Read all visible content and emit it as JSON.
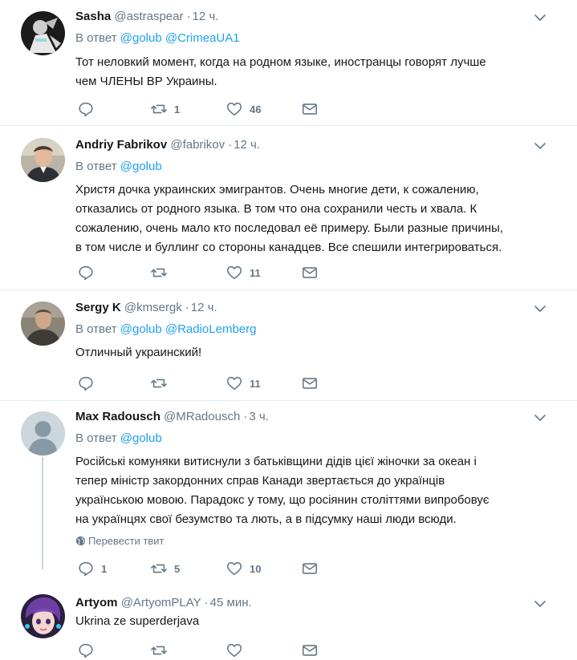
{
  "tweets": [
    {
      "name": "Sasha",
      "handle": "@astraspear",
      "time": "12 ч.",
      "reply_prefix": "В ответ",
      "mentions": [
        "@golub",
        "@CrimeaUA1"
      ],
      "lines": [
        "Тот неловкий момент, когда на родном языке, иностранцы говорят лучше",
        "чем ЧЛЕНЫ ВР Украины."
      ],
      "reply_count": "",
      "retweet_count": "1",
      "like_count": "46"
    },
    {
      "name": "Andriy Fabrikov",
      "handle": "@fabrikov",
      "time": "12 ч.",
      "reply_prefix": "В ответ",
      "mentions": [
        "@golub"
      ],
      "lines": [
        "Христя дочка украинских эмигрантов. Очень многие дети, к сожалению,",
        "отказались от родного языка. В том что она сохранили честь и хвала. К",
        "сожалению, очень мало кто последовал её примеру. Были разные причины,",
        "в том числе и буллинг со стороны канадцев. Все спешили интегрироваться."
      ],
      "reply_count": "",
      "retweet_count": "",
      "like_count": "11"
    },
    {
      "name": "Sergy K",
      "handle": "@kmsergk",
      "time": "12 ч.",
      "reply_prefix": "В ответ",
      "mentions": [
        "@golub",
        "@RadioLemberg"
      ],
      "lines": [
        "Отличный украинский!"
      ],
      "reply_count": "",
      "retweet_count": "",
      "like_count": "11"
    },
    {
      "name": "Max Radousch",
      "handle": "@MRadousch",
      "time": "3 ч.",
      "reply_prefix": "В ответ",
      "mentions": [
        "@golub"
      ],
      "lines": [
        "Російські комуняки витиснули з батьківщини дідів цієї жіночки за океан і",
        "тепер міністр закордонних справ Канади звертається до українців",
        "українською мовою. Парадокс у тому, що росіянин століттями випробовує",
        "на українцях свої безумство та лють, а в підсумку наші люди всюди."
      ],
      "translate_label": "Перевести твит",
      "reply_count": "1",
      "retweet_count": "5",
      "like_count": "10"
    },
    {
      "name": "Artyom",
      "handle": "@ArtyomPLAY",
      "time": "45 мин.",
      "lines": [
        "Ukrina ze superderjava"
      ],
      "reply_count": "",
      "retweet_count": "",
      "like_count": ""
    }
  ],
  "icons": {
    "reply": "reply-icon",
    "retweet": "retweet-icon",
    "like": "heart-icon",
    "dm": "envelope-icon",
    "caret": "chevron-down-icon",
    "globe": "globe-icon"
  },
  "colors": {
    "link": "#1da1f2",
    "muted": "#657786",
    "icon": "#657786",
    "divider": "#e6ecf0"
  }
}
